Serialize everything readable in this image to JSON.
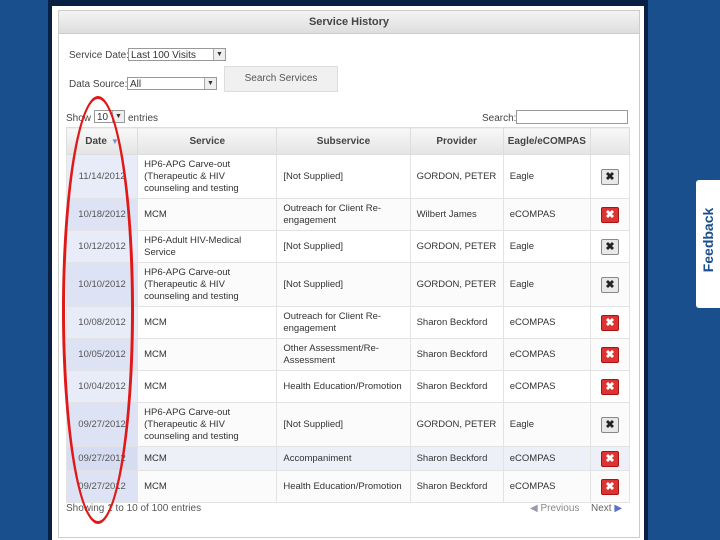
{
  "panel": {
    "title": "Service History",
    "feedback": "Feedback"
  },
  "filters": {
    "service_date_label": "Service Date:",
    "service_date_value": "Last 100 Visits",
    "data_source_label": "Data Source:",
    "data_source_value": "All",
    "search_button": "Search Services"
  },
  "table_controls": {
    "show_label": "Show",
    "entries_value": "10",
    "entries_label": "entries",
    "search_label": "Search:"
  },
  "columns": [
    "Date",
    "Service",
    "Subservice",
    "Provider",
    "Eagle/eCOMPAS"
  ],
  "rows": [
    {
      "date": "11/14/2012",
      "service": "HP6-APG Carve-out (Therapeutic & HIV counseling and testing",
      "subservice": "[Not Supplied]",
      "provider": "GORDON, PETER",
      "source": "Eagle",
      "del": "gray"
    },
    {
      "date": "10/18/2012",
      "service": "MCM",
      "subservice": "Outreach for Client Re-engagement",
      "provider": "Wilbert James",
      "source": "eCOMPAS",
      "del": "red"
    },
    {
      "date": "10/12/2012",
      "service": "HP6-Adult HIV-Medical Service",
      "subservice": "[Not Supplied]",
      "provider": "GORDON, PETER",
      "source": "Eagle",
      "del": "gray"
    },
    {
      "date": "10/10/2012",
      "service": "HP6-APG Carve-out (Therapeutic & HIV counseling and testing",
      "subservice": "[Not Supplied]",
      "provider": "GORDON, PETER",
      "source": "Eagle",
      "del": "gray"
    },
    {
      "date": "10/08/2012",
      "service": "MCM",
      "subservice": "Outreach for Client Re-engagement",
      "provider": "Sharon Beckford",
      "source": "eCOMPAS",
      "del": "red"
    },
    {
      "date": "10/05/2012",
      "service": "MCM",
      "subservice": "Other Assessment/Re-Assessment",
      "provider": "Sharon Beckford",
      "source": "eCOMPAS",
      "del": "red"
    },
    {
      "date": "10/04/2012",
      "service": "MCM",
      "subservice": "Health Education/Promotion",
      "provider": "Sharon Beckford",
      "source": "eCOMPAS",
      "del": "red"
    },
    {
      "date": "09/27/2012",
      "service": "HP6-APG Carve-out (Therapeutic & HIV counseling and testing",
      "subservice": "[Not Supplied]",
      "provider": "GORDON, PETER",
      "source": "Eagle",
      "del": "gray"
    },
    {
      "date": "09/27/2012",
      "service": "MCM",
      "subservice": "Accompaniment",
      "provider": "Sharon Beckford",
      "source": "eCOMPAS",
      "del": "red"
    },
    {
      "date": "09/27/2012",
      "service": "MCM",
      "subservice": "Health Education/Promotion",
      "provider": "Sharon Beckford",
      "source": "eCOMPAS",
      "del": "red"
    }
  ],
  "footer": {
    "info": "Showing 1 to 10 of 100 entries",
    "previous": "Previous",
    "next": "Next"
  },
  "colors": {
    "annotation_oval": "#e01818",
    "frame": "#1a4f8e"
  }
}
